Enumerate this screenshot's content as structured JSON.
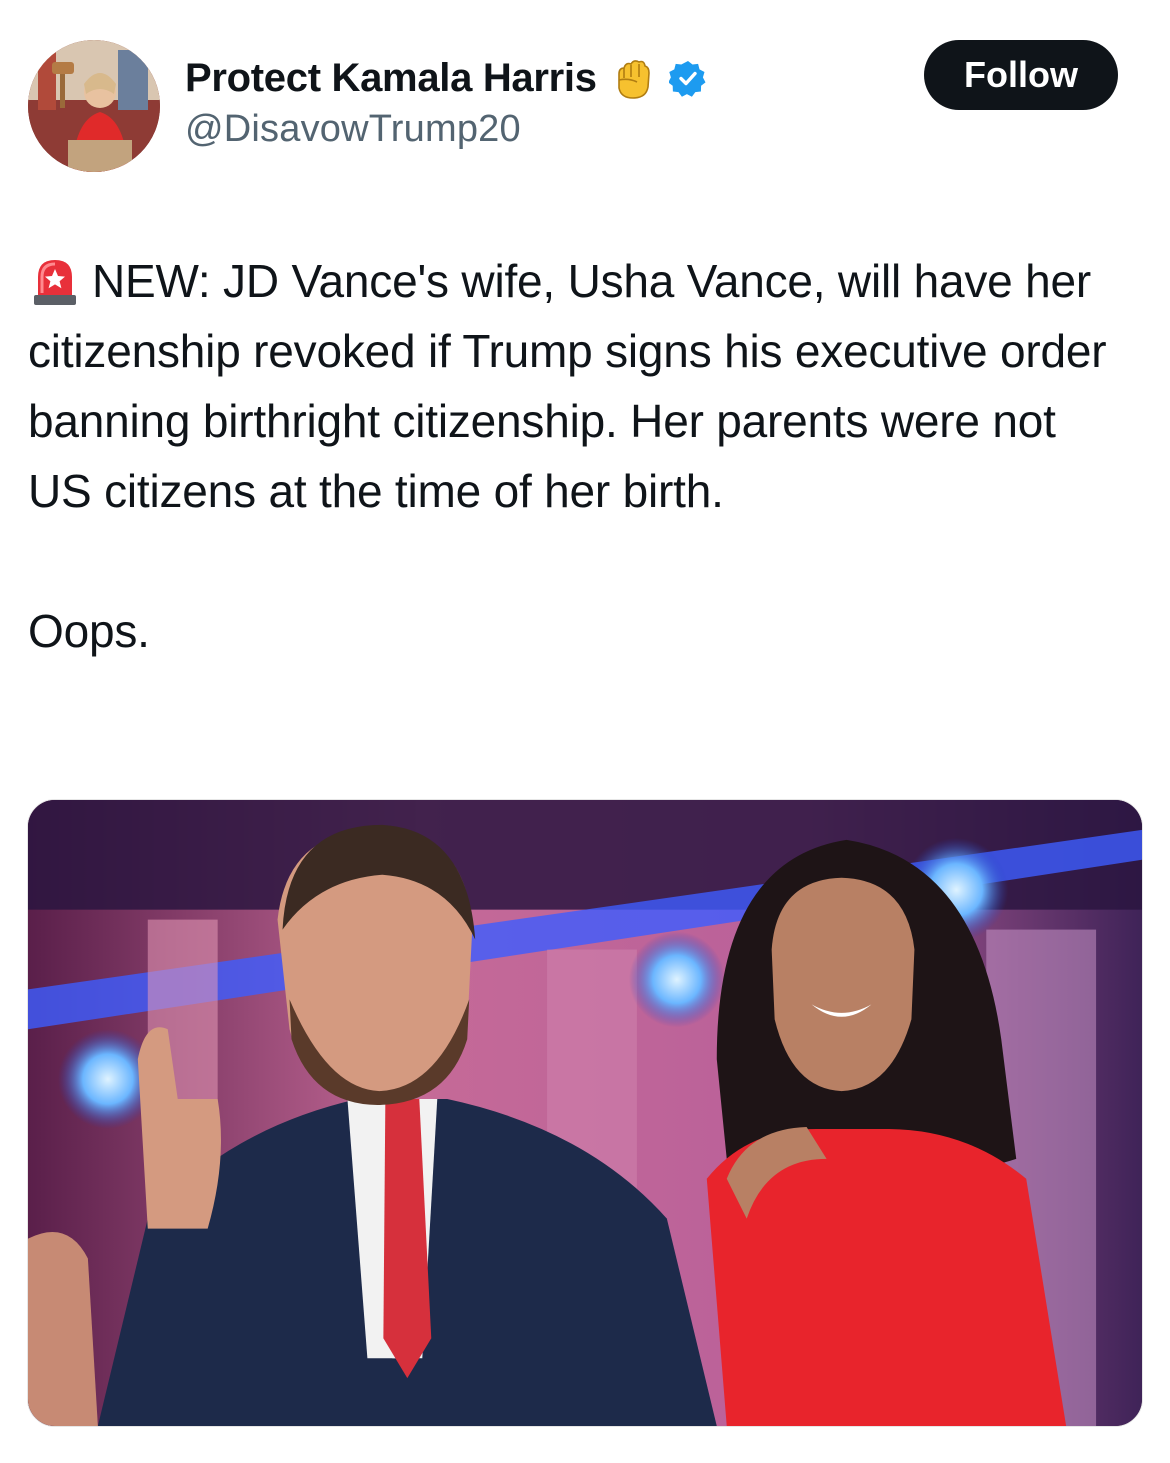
{
  "author": {
    "display_name": "Protect Kamala Harris",
    "handle": "@DisavowTrump20",
    "verified": true,
    "name_emoji": "raised-fist-icon",
    "verified_color": "#1d9bf0"
  },
  "actions": {
    "follow_label": "Follow"
  },
  "post": {
    "lead_emoji": "police-siren-icon",
    "paragraph_1": "NEW: JD Vance's wife, Usha Vance, will have her citizenship revoked if Trump signs his executive order banning birthright citizenship. Her parents were not US citizens at the time of her birth.",
    "paragraph_2": "Oops."
  },
  "media": {
    "kind": "photo"
  },
  "colors": {
    "text": "#0f1419",
    "secondary": "#536471",
    "button_bg": "#0f1419",
    "button_text": "#ffffff"
  }
}
